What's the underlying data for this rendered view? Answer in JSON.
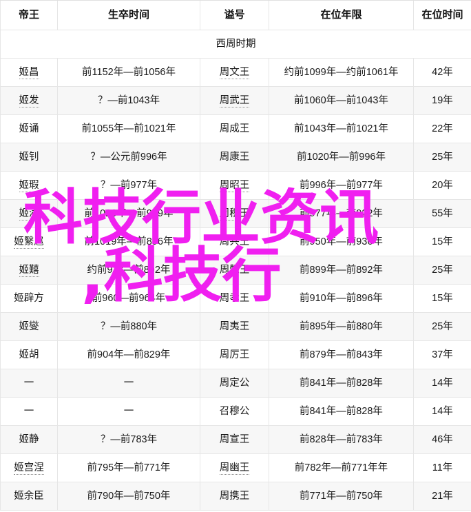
{
  "table": {
    "columns": [
      "帝王",
      "生卒时间",
      "谥号",
      "在位年限",
      "在位时间"
    ],
    "section_label": "西周时期",
    "rows": [
      {
        "name": "姬昌",
        "life": "前1152年—前1056年",
        "title": "周文王",
        "reign": "约前1099年—约前1061年",
        "years": "42年"
      },
      {
        "name": "姬发",
        "life": "？—前1043年",
        "title": "周武王",
        "reign": "前1060年—前1043年",
        "years": "19年"
      },
      {
        "name": "姬诵",
        "life": "前1055年—前1021年",
        "title": "周成王",
        "reign": "前1043年—前1021年",
        "years": "22年"
      },
      {
        "name": "姬钊",
        "life": "？—公元前996年",
        "title": "周康王",
        "reign": "前1020年—前996年",
        "years": "25年"
      },
      {
        "name": "姬瑕",
        "life": "？—前977年",
        "title": "周昭王",
        "reign": "前996年—前977年",
        "years": "20年"
      },
      {
        "name": "姬满",
        "life": "前1026年—前949年",
        "title": "周穆王",
        "reign": "前977年—前922年",
        "years": "55年"
      },
      {
        "name": "姬繄扈",
        "life": "前1019年—前896年",
        "title": "周共王",
        "reign": "前950年—前936年",
        "years": "15年"
      },
      {
        "name": "姬囏",
        "life": "约前937—前892年",
        "title": "周懿王",
        "reign": "前899年—前892年",
        "years": "25年"
      },
      {
        "name": "姬辟方",
        "life": "前960—前964年",
        "title": "周孝王",
        "reign": "前910年—前896年",
        "years": "15年"
      },
      {
        "name": "姬燮",
        "life": "？—前880年",
        "title": "周夷王",
        "reign": "前895年—前880年",
        "years": "25年"
      },
      {
        "name": "姬胡",
        "life": "前904年—前829年",
        "title": "周厉王",
        "reign": "前879年—前843年",
        "years": "37年"
      },
      {
        "name": "一",
        "life": "一",
        "title": "周定公",
        "reign": "前841年—前828年",
        "years": "14年"
      },
      {
        "name": "一",
        "life": "一",
        "title": "召穆公",
        "reign": "前841年—前828年",
        "years": "14年"
      },
      {
        "name": "姬静",
        "life": "？—前783年",
        "title": "周宣王",
        "reign": "前828年—前783年",
        "years": "46年"
      },
      {
        "name": "姬宫涅",
        "life": "前795年—前771年",
        "title": "周幽王",
        "reign": "前782年—前771年年",
        "years": "11年"
      },
      {
        "name": "姬余臣",
        "life": "前790年—前750年",
        "title": "周携王",
        "reign": "前771年—前750年",
        "years": "21年"
      }
    ]
  },
  "watermark": {
    "line1": "科技行业资讯",
    "line2": ",科技行",
    "color": "#f01ff0"
  }
}
